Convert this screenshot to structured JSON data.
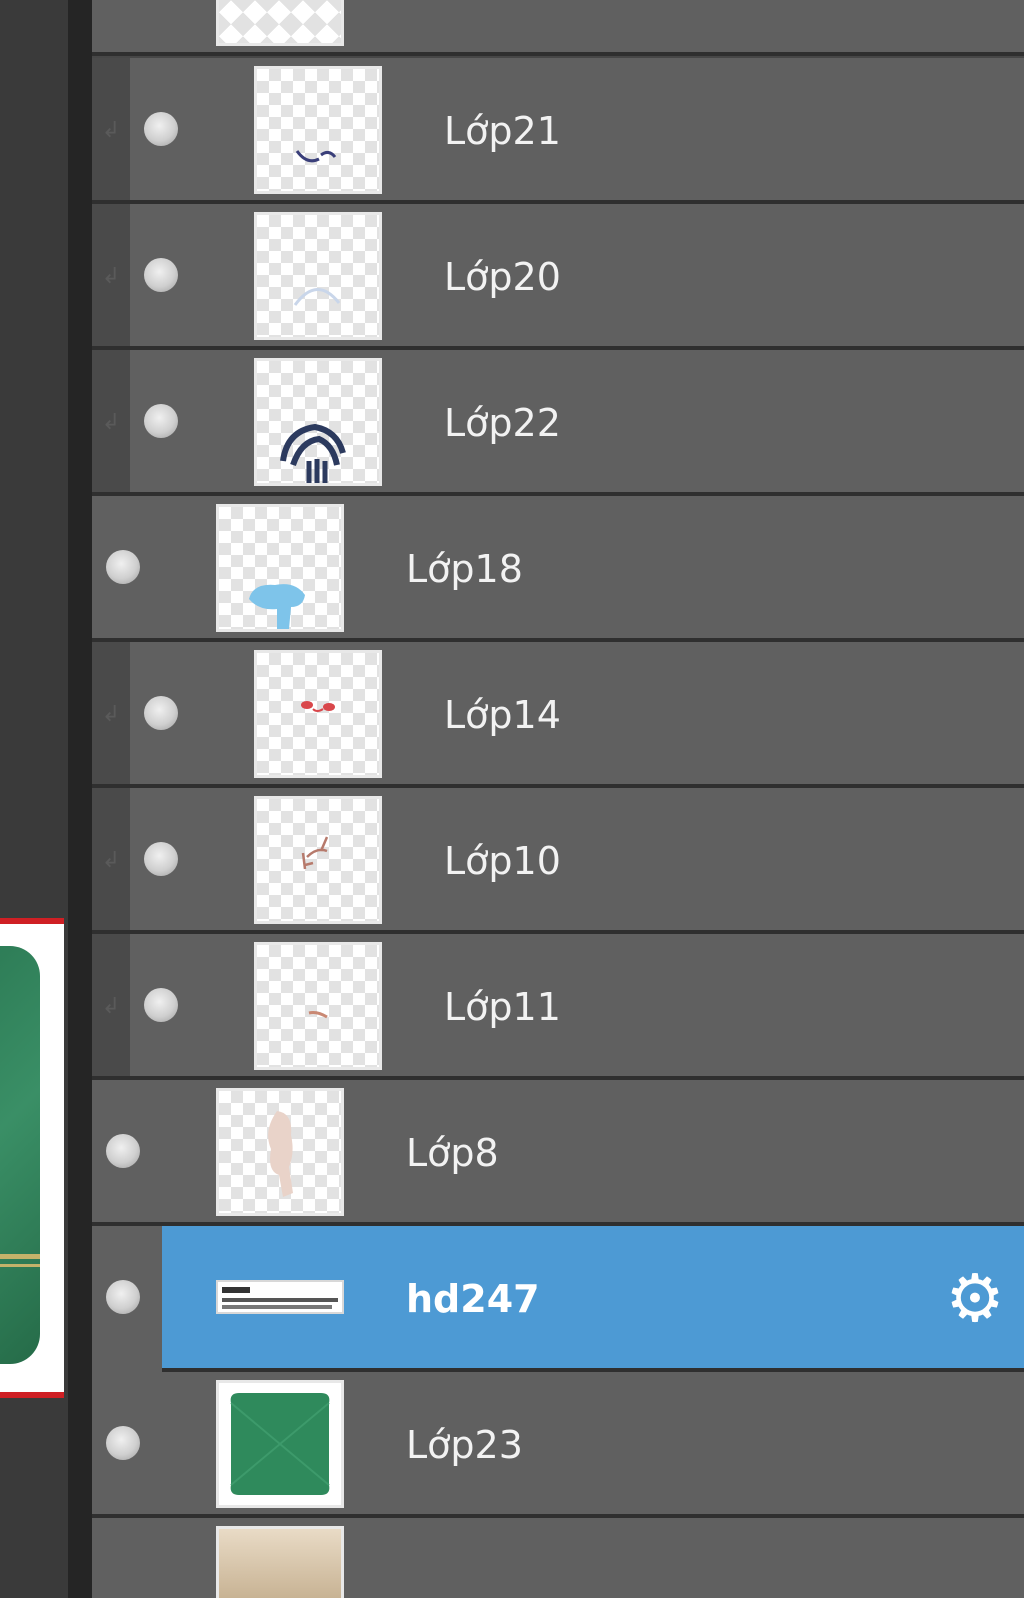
{
  "layers": [
    {
      "name": "",
      "kind": "partial-top"
    },
    {
      "name": "Lớp21",
      "clipped": true
    },
    {
      "name": "Lớp20",
      "clipped": true
    },
    {
      "name": "Lớp22",
      "clipped": true
    },
    {
      "name": "Lớp18",
      "clipped": false
    },
    {
      "name": "Lớp14",
      "clipped": true
    },
    {
      "name": "Lớp10",
      "clipped": true
    },
    {
      "name": "Lớp11",
      "clipped": true
    },
    {
      "name": "Lớp8",
      "clipped": false
    },
    {
      "name": "hd247",
      "clipped": false,
      "selected": true
    },
    {
      "name": "Lớp23",
      "clipped": false
    }
  ],
  "icons": {
    "visibility": "eye-dot-icon",
    "clip": "clipping-arrow-icon",
    "settings": "gear-icon"
  },
  "colors": {
    "panel_row": "#606060",
    "selected_row": "#4d9ad4",
    "canvas_border": "#cf1f24",
    "canvas_green": "#2e7d57"
  }
}
